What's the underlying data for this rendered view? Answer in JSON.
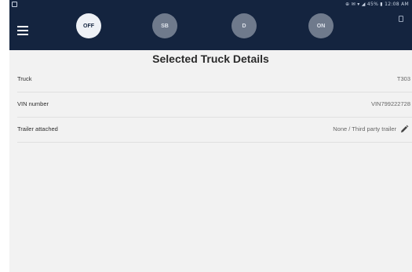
{
  "status_bar": {
    "right_text": "⊕ ✉ ▾ ◢ 45% ▮ 12:08 AM"
  },
  "app_bar": {
    "menu_icon": "hamburger-menu-icon",
    "duty_buttons": [
      {
        "label": "OFF",
        "selected": true
      },
      {
        "label": "SB",
        "selected": false
      },
      {
        "label": "D",
        "selected": false
      },
      {
        "label": "ON",
        "selected": false
      }
    ],
    "right_icon": "clipboard-icon"
  },
  "page": {
    "title": "Selected Truck Details",
    "rows": [
      {
        "label": "Truck",
        "value": "T303"
      },
      {
        "label": "VIN number",
        "value": "VIN799222728"
      },
      {
        "label": "Trailer attached",
        "value": "None / Third party trailer",
        "icon": "pencil-icon"
      }
    ]
  },
  "colors": {
    "header": "#14243f",
    "background": "#f2f2f2",
    "active_duty": "#eef1f6",
    "inactive_duty": "#6f7a8c"
  }
}
